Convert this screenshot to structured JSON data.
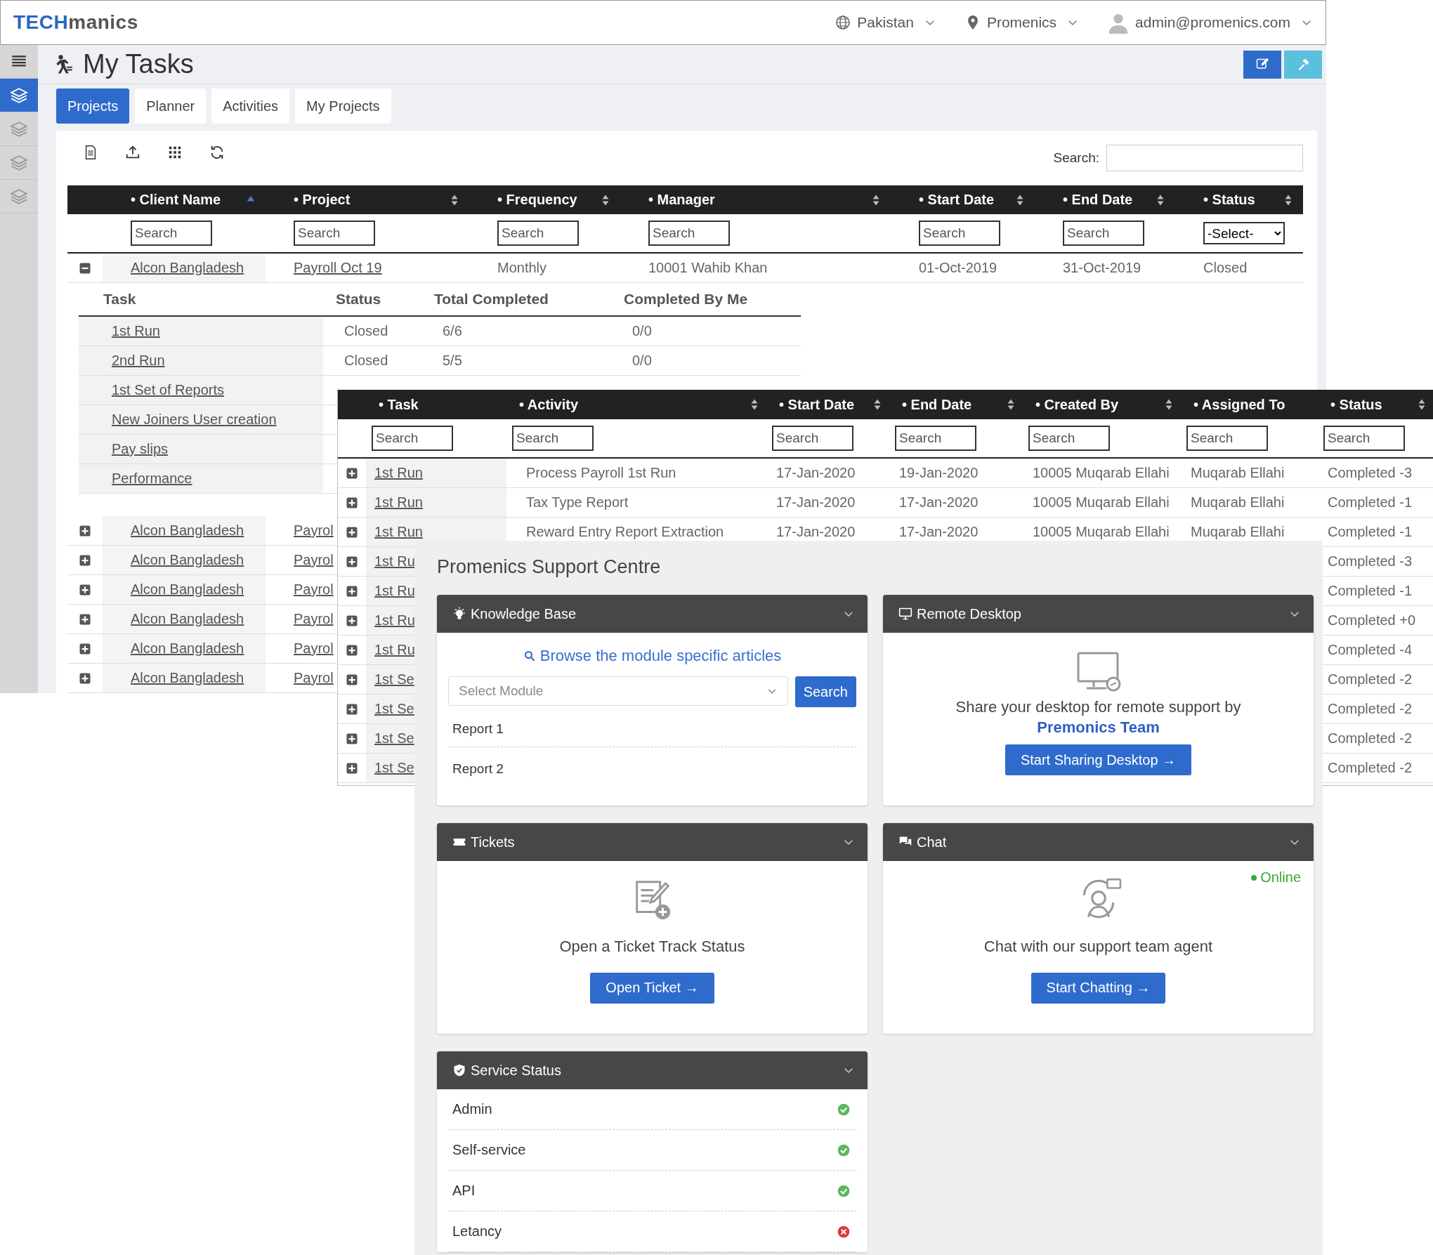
{
  "header": {
    "logo_primary": "TECH",
    "logo_secondary": "manics",
    "country": "Pakistan",
    "company": "Promenics",
    "user": "admin@promenics.com"
  },
  "sidebar": {
    "items": [
      {
        "kind": "menu",
        "selected": false
      },
      {
        "kind": "layers",
        "selected": true
      },
      {
        "kind": "layers",
        "selected": false
      },
      {
        "kind": "layers",
        "selected": false
      },
      {
        "kind": "layers",
        "selected": false
      }
    ]
  },
  "page": {
    "title": "My Tasks"
  },
  "tabs": [
    {
      "label": "Projects",
      "selected": true
    },
    {
      "label": "Planner",
      "selected": false
    },
    {
      "label": "Activities",
      "selected": false
    },
    {
      "label": "My Projects",
      "selected": false
    }
  ],
  "projects_table": {
    "search_label": "Search:",
    "columns": [
      {
        "label": "• Client Name",
        "sortable": true,
        "sorted": true
      },
      {
        "label": "• Project",
        "sortable": true,
        "sorted": false
      },
      {
        "label": "• Frequency",
        "sortable": true,
        "sorted": false
      },
      {
        "label": "• Manager",
        "sortable": true,
        "sorted": false
      },
      {
        "label": "• Start Date",
        "sortable": true,
        "sorted": false
      },
      {
        "label": "• End Date",
        "sortable": true,
        "sorted": false
      },
      {
        "label": "• Status",
        "sortable": true,
        "sorted": false
      }
    ],
    "filters": [
      {
        "kind": "text",
        "placeholder": "Search"
      },
      {
        "kind": "text",
        "placeholder": "Search"
      },
      {
        "kind": "text",
        "placeholder": "Search"
      },
      {
        "kind": "text",
        "placeholder": "Search"
      },
      {
        "kind": "text",
        "placeholder": "Search"
      },
      {
        "kind": "text",
        "placeholder": "Search"
      },
      {
        "kind": "select",
        "value": "-Select-"
      }
    ],
    "rows": [
      {
        "expanded": true,
        "client": "Alcon Bangladesh",
        "project": "Payroll Oct 19",
        "frequency": "Monthly",
        "manager": "10001 Wahib Khan",
        "start": "01-Oct-2019",
        "end": "31-Oct-2019",
        "status": "Closed",
        "children": {
          "columns": [
            "Task",
            "Status",
            "Total Completed",
            "Completed By Me"
          ],
          "rows": [
            {
              "task": "1st Run",
              "status": "Closed",
              "total": "6/6",
              "mine": "0/0"
            },
            {
              "task": "2nd Run",
              "status": "Closed",
              "total": "5/5",
              "mine": "0/0"
            },
            {
              "task": "1st Set of Reports"
            },
            {
              "task": "New Joiners User creation"
            },
            {
              "task": "Pay slips"
            },
            {
              "task": "Performance"
            }
          ]
        }
      },
      {
        "expanded": false,
        "client": "Alcon Bangladesh",
        "project": "Payrol"
      },
      {
        "expanded": false,
        "client": "Alcon Bangladesh",
        "project": "Payrol"
      },
      {
        "expanded": false,
        "client": "Alcon Bangladesh",
        "project": "Payrol"
      },
      {
        "expanded": false,
        "client": "Alcon Bangladesh",
        "project": "Payrol"
      },
      {
        "expanded": false,
        "client": "Alcon Bangladesh",
        "project": "Payrol"
      },
      {
        "expanded": false,
        "client": "Alcon Bangladesh",
        "project": "Payrol"
      }
    ]
  },
  "activities_table": {
    "columns": [
      {
        "label": "• Task",
        "sortable": false
      },
      {
        "label": "• Activity",
        "sortable": true
      },
      {
        "label": "• Start Date",
        "sortable": true
      },
      {
        "label": "• End Date",
        "sortable": true
      },
      {
        "label": "• Created By",
        "sortable": true
      },
      {
        "label": "• Assigned To",
        "sortable": false
      },
      {
        "label": "• Status",
        "sortable": true
      }
    ],
    "filters": [
      {
        "placeholder": "Search"
      },
      {
        "placeholder": "Search"
      },
      {
        "placeholder": "Search"
      },
      {
        "placeholder": "Search"
      },
      {
        "placeholder": "Search"
      },
      {
        "placeholder": "Search"
      },
      {
        "placeholder": "Search"
      }
    ],
    "rows": [
      {
        "expanded": false,
        "task": "1st Run",
        "activity": "Process Payroll 1st Run",
        "start": "17-Jan-2020",
        "end": "19-Jan-2020",
        "created_by": "10005 Muqarab Ellahi",
        "assigned_to": "Muqarab Ellahi",
        "status": "Completed -3"
      },
      {
        "expanded": false,
        "task": "1st Run",
        "activity": "Tax Type Report",
        "start": "17-Jan-2020",
        "end": "17-Jan-2020",
        "created_by": "10005 Muqarab Ellahi",
        "assigned_to": "Muqarab Ellahi",
        "status": "Completed -1"
      },
      {
        "expanded": false,
        "task": "1st Run",
        "activity": "Reward Entry Report Extraction",
        "start": "17-Jan-2020",
        "end": "17-Jan-2020",
        "created_by": "10005 Muqarab Ellahi",
        "assigned_to": "Muqarab Ellahi",
        "status": "Completed -1"
      },
      {
        "expanded": false,
        "task": "1st Ru",
        "status": "Completed -3"
      },
      {
        "expanded": false,
        "task": "1st Ru",
        "status": "Completed -1"
      },
      {
        "expanded": false,
        "task": "1st Ru",
        "status": "Completed +0"
      },
      {
        "expanded": false,
        "task": "1st Ru",
        "status": "Completed -4"
      },
      {
        "expanded": false,
        "task": "1st Se",
        "status": "Completed -2"
      },
      {
        "expanded": false,
        "task": "1st Se",
        "status": "Completed -2"
      },
      {
        "expanded": false,
        "task": "1st Se",
        "status": "Completed -2"
      },
      {
        "expanded": false,
        "task": "1st Se",
        "status": "Completed -2"
      }
    ]
  },
  "support": {
    "title": "Promenics Support Centre",
    "cards": [
      {
        "kind": "knowledge",
        "title": "Knowledge Base",
        "link": "Browse the module specific articles",
        "select_placeholder": "Select Module",
        "button": "Search",
        "items": [
          "Report 1",
          "Report 2"
        ]
      },
      {
        "kind": "remote",
        "title": "Remote Desktop",
        "text": "Share your desktop for remote support by **Premonics Team**",
        "button": "Start Sharing Desktop →"
      },
      {
        "kind": "tickets",
        "title": "Tickets",
        "text": "Open a Ticket Track Status",
        "button": "Open Ticket →"
      },
      {
        "kind": "chat",
        "title": "Chat",
        "status": {
          "label": "Online",
          "color": "#3aaa35"
        },
        "text": "Chat with our support team agent",
        "button": "Start Chatting →"
      },
      {
        "kind": "status",
        "title": "Service Status",
        "services": [
          {
            "name": "Admin",
            "up": true
          },
          {
            "name": "Self-service",
            "up": true
          },
          {
            "name": "API",
            "up": true
          },
          {
            "name": "Letancy",
            "up": false
          }
        ]
      }
    ]
  }
}
